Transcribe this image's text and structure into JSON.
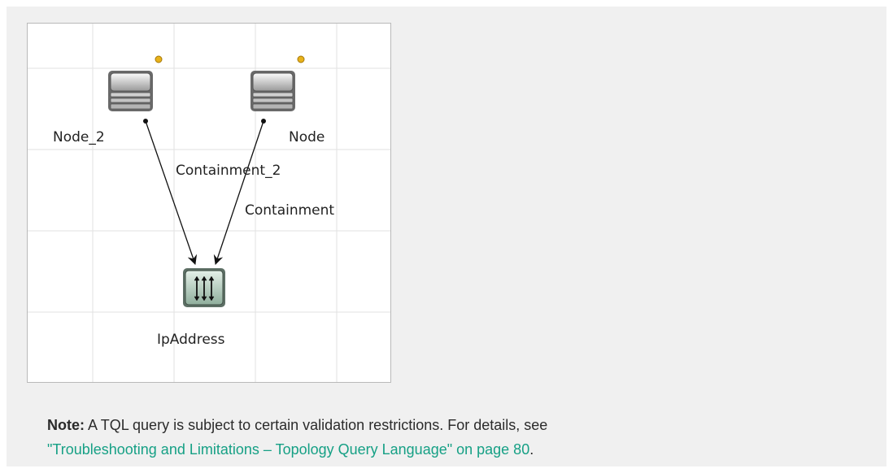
{
  "diagram": {
    "nodes": [
      {
        "id": "node_2",
        "label": "Node_2",
        "icon": "server-icon",
        "badge": "gold-dot-icon"
      },
      {
        "id": "node",
        "label": "Node",
        "icon": "server-icon",
        "badge": "gold-dot-icon"
      },
      {
        "id": "ipaddress",
        "label": "IpAddress",
        "icon": "ip-address-icon"
      }
    ],
    "edges": [
      {
        "from": "ipaddress",
        "to": "node_2",
        "label": "Containment_2"
      },
      {
        "from": "ipaddress",
        "to": "node",
        "label": "Containment"
      }
    ]
  },
  "note": {
    "heading": "Note:",
    "text": " A TQL query is subject to certain validation restrictions. For details, see",
    "link": "\"Troubleshooting and Limitations – Topology Query Language\" on page 80",
    "suffix": "."
  },
  "colors": {
    "link": "#16a085",
    "background": "#f0f0f0",
    "grid": "#e2e2e2",
    "badge": "#e8b21a"
  }
}
